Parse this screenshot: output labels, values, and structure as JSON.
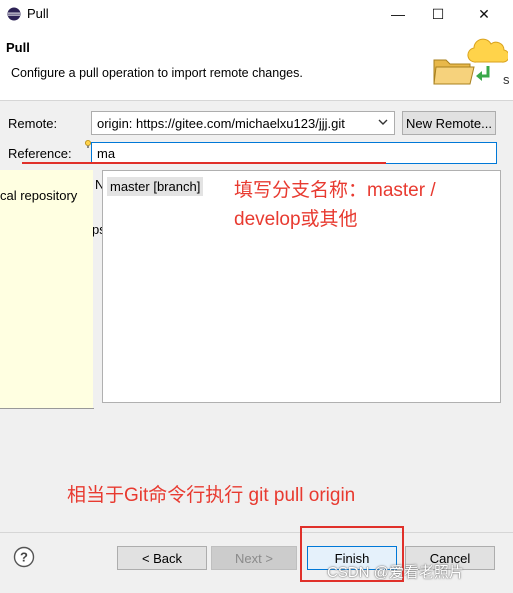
{
  "window": {
    "title": "Pull",
    "minimize_glyph": "—",
    "maximize_glyph": "☐",
    "close_glyph": "✕"
  },
  "header": {
    "title": "Pull",
    "description": "Configure a pull operation to import remote changes.",
    "cut_off_text": "s"
  },
  "form": {
    "remote_label": "Remote:",
    "remote_value": "origin: https://gitee.com/michaelxu123/jjj.git",
    "new_remote_button": "New Remote...",
    "reference_label": "Reference:",
    "reference_value": "ma"
  },
  "popup": {
    "items": [
      "master [branch]"
    ],
    "clipped_letter_left": "N",
    "clipped_letter_right": "ps"
  },
  "content_assist_panel": {
    "text": "cal repository"
  },
  "annotations": {
    "line1": "填写分支名称：master /",
    "line2": "develop或其他",
    "line3": "相当于Git命令行执行 git pull origin"
  },
  "footer": {
    "back_button": "< Back",
    "next_button": "Next >",
    "finish_button": "Finish",
    "cancel_button": "Cancel"
  },
  "watermark": "CSDN @爱看老照片",
  "colors": {
    "annotation_red": "#e83a30",
    "focus_blue": "#0078d7"
  }
}
